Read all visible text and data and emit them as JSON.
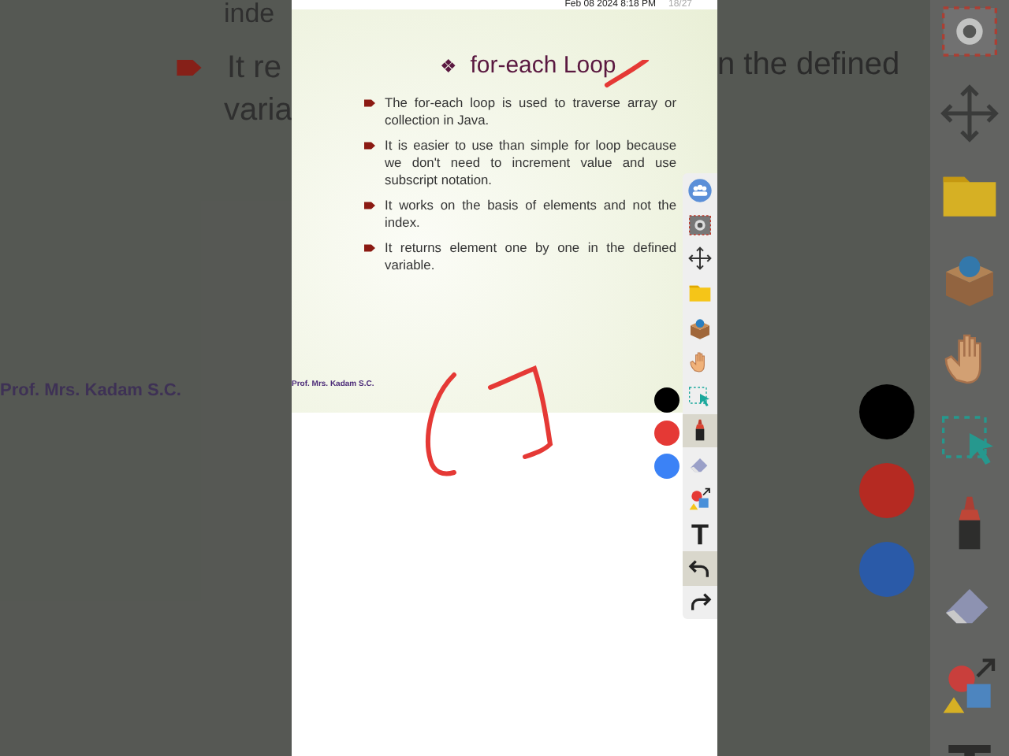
{
  "slide": {
    "header": {
      "date": "Feb 08 2024 8:18 PM",
      "page": "18/27"
    },
    "title_mark": "❖",
    "title": "for-each Loop",
    "bullets": [
      "The for-each loop is used to traverse array or collection in Java.",
      "It is easier to use than simple for loop because we don't need to increment value and use subscript notation.",
      "It works on the basis of elements and not the index.",
      "It returns element one by one in the defined variable."
    ],
    "footer": "Prof. Mrs. Kadam S.C."
  },
  "tools": [
    {
      "kind": "group",
      "selected": false
    },
    {
      "kind": "capture",
      "selected": false
    },
    {
      "kind": "move",
      "selected": false
    },
    {
      "kind": "folder",
      "selected": false
    },
    {
      "kind": "box",
      "selected": false
    },
    {
      "kind": "hand",
      "selected": false
    },
    {
      "kind": "select",
      "selected": false
    },
    {
      "kind": "marker",
      "selected": true
    },
    {
      "kind": "eraser",
      "selected": false
    },
    {
      "kind": "shapes",
      "selected": false
    },
    {
      "kind": "text",
      "selected": false
    },
    {
      "kind": "undo",
      "selected": true
    },
    {
      "kind": "redo",
      "selected": false
    }
  ],
  "pen_colors": [
    {
      "color": "#000000"
    },
    {
      "color": "#e53935"
    },
    {
      "color": "#3b82f6"
    }
  ],
  "backdrop_left": {
    "line_1": "inde",
    "line_2": "It re",
    "line_3": "varia",
    "footer": "Prof. Mrs. Kadam S.C."
  },
  "backdrop_right": {
    "text": "n the defined",
    "pen_colors": [
      {
        "color": "#000000"
      },
      {
        "color": "#b52a22"
      },
      {
        "color": "#2a5aa8"
      }
    ],
    "tools": [
      {
        "kind": "capture"
      },
      {
        "kind": "move"
      },
      {
        "kind": "folder"
      },
      {
        "kind": "box"
      },
      {
        "kind": "hand"
      },
      {
        "kind": "select"
      },
      {
        "kind": "marker"
      },
      {
        "kind": "eraser"
      },
      {
        "kind": "shapes"
      },
      {
        "kind": "text"
      }
    ]
  }
}
